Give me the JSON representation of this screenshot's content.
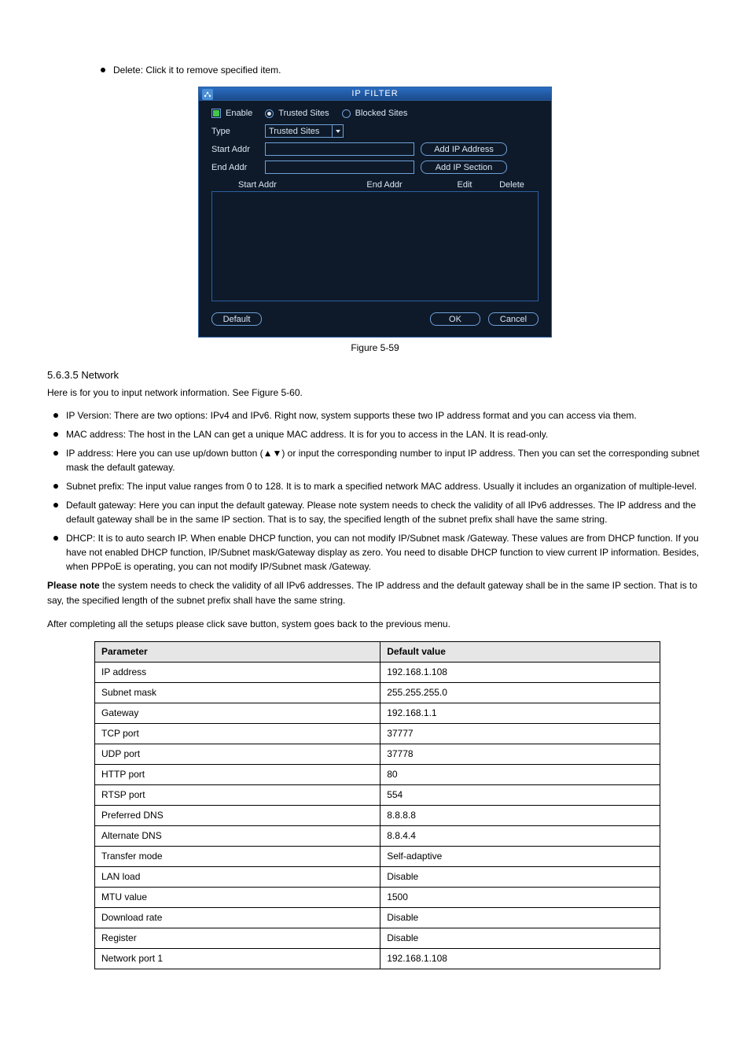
{
  "top_bullet": "Delete: Click it to remove specified item.",
  "figure": {
    "title": "IP FILTER",
    "enable_label": "Enable",
    "trusted_sites_label": "Trusted Sites",
    "blocked_sites_label": "Blocked Sites",
    "type_label": "Type",
    "type_value": "Trusted Sites",
    "start_addr_label": "Start Addr",
    "end_addr_label": "End Addr",
    "add_ip_address_btn": "Add IP Address",
    "add_ip_section_btn": "Add IP Section",
    "col_start": "Start Addr",
    "col_end": "End Addr",
    "col_edit": "Edit",
    "col_delete": "Delete",
    "default_btn": "Default",
    "ok_btn": "OK",
    "cancel_btn": "Cancel",
    "caption": "Figure 5-59"
  },
  "section_heading": "5.6.3.5 Network",
  "para1": "Here is for you to input network information. See Figure 5-60.",
  "bullets2": [
    "IP Version: There are two options: IPv4 and IPv6. Right now, system supports these two IP address format and you can access via them.",
    "MAC address: The host in the LAN can get a unique MAC address. It is for you to access in the LAN. It is read-only.",
    "IP address: Here you can use up/down button (▲▼) or input the corresponding number to input IP address. Then you can set the corresponding subnet mask the default gateway.",
    "Subnet prefix: The input value ranges from 0 to 128. It is to mark a specified network MAC address. Usually it includes an organization of multiple-level.",
    "Default gateway: Here you can input the default gateway. Please note system needs to check the validity of all IPv6 addresses. The IP address and the default gateway shall be in the same IP section. That is to say, the specified length of the subnet prefix shall have the same string.",
    "DHCP: It is to auto search IP. When enable DHCP function, you can not modify IP/Subnet mask /Gateway. These values are from DHCP function. If you have not enabled DHCP function, IP/Subnet mask/Gateway display as zero. You need to disable DHCP function to view current IP information. Besides, when PPPoE is operating, you can not modify IP/Subnet mask /Gateway."
  ],
  "para2_strong": "Please note ",
  "para2_rest": "the system needs to check the validity of all IPv6 addresses. The IP address and the default gateway shall be in the same IP section. That is to say, the specified length of the subnet prefix shall have the same string.",
  "para3": "After completing all the setups please click save button, system goes back to the previous menu.",
  "table": {
    "head": [
      "Parameter",
      "Default value"
    ],
    "rows": [
      [
        "IP address",
        "192.168.1.108"
      ],
      [
        "Subnet mask",
        "255.255.255.0"
      ],
      [
        "Gateway",
        "192.168.1.1"
      ],
      [
        "TCP port",
        "37777"
      ],
      [
        "UDP port",
        "37778"
      ],
      [
        "HTTP port",
        "80"
      ],
      [
        "RTSP port",
        "554"
      ],
      [
        "Preferred DNS",
        "8.8.8.8"
      ],
      [
        "Alternate DNS",
        "8.8.4.4"
      ],
      [
        "Transfer mode",
        "Self-adaptive"
      ],
      [
        "LAN load",
        "Disable"
      ],
      [
        "MTU value",
        "1500"
      ],
      [
        "Download rate",
        "Disable"
      ],
      [
        "Register",
        "Disable"
      ],
      [
        "Network port 1",
        "192.168.1.108"
      ]
    ]
  }
}
